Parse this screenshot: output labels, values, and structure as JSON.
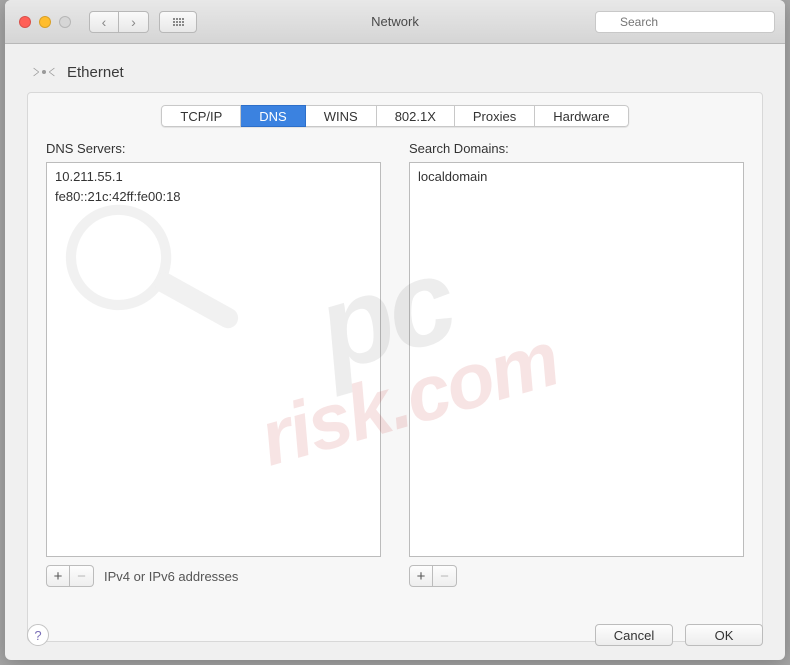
{
  "window": {
    "title": "Network",
    "search_placeholder": "Search"
  },
  "section": {
    "title": "Ethernet"
  },
  "tabs": [
    {
      "label": "TCP/IP",
      "selected": false
    },
    {
      "label": "DNS",
      "selected": true
    },
    {
      "label": "WINS",
      "selected": false
    },
    {
      "label": "802.1X",
      "selected": false
    },
    {
      "label": "Proxies",
      "selected": false
    },
    {
      "label": "Hardware",
      "selected": false
    }
  ],
  "dns": {
    "label": "DNS Servers:",
    "items": [
      "10.211.55.1",
      "fe80::21c:42ff:fe00:18"
    ],
    "hint": "IPv4 or IPv6 addresses"
  },
  "domains": {
    "label": "Search Domains:",
    "items": [
      "localdomain"
    ]
  },
  "buttons": {
    "add": "+",
    "remove": "−",
    "help": "?",
    "cancel": "Cancel",
    "ok": "OK"
  },
  "watermark": {
    "line1": "pc",
    "line2": "risk.com"
  }
}
